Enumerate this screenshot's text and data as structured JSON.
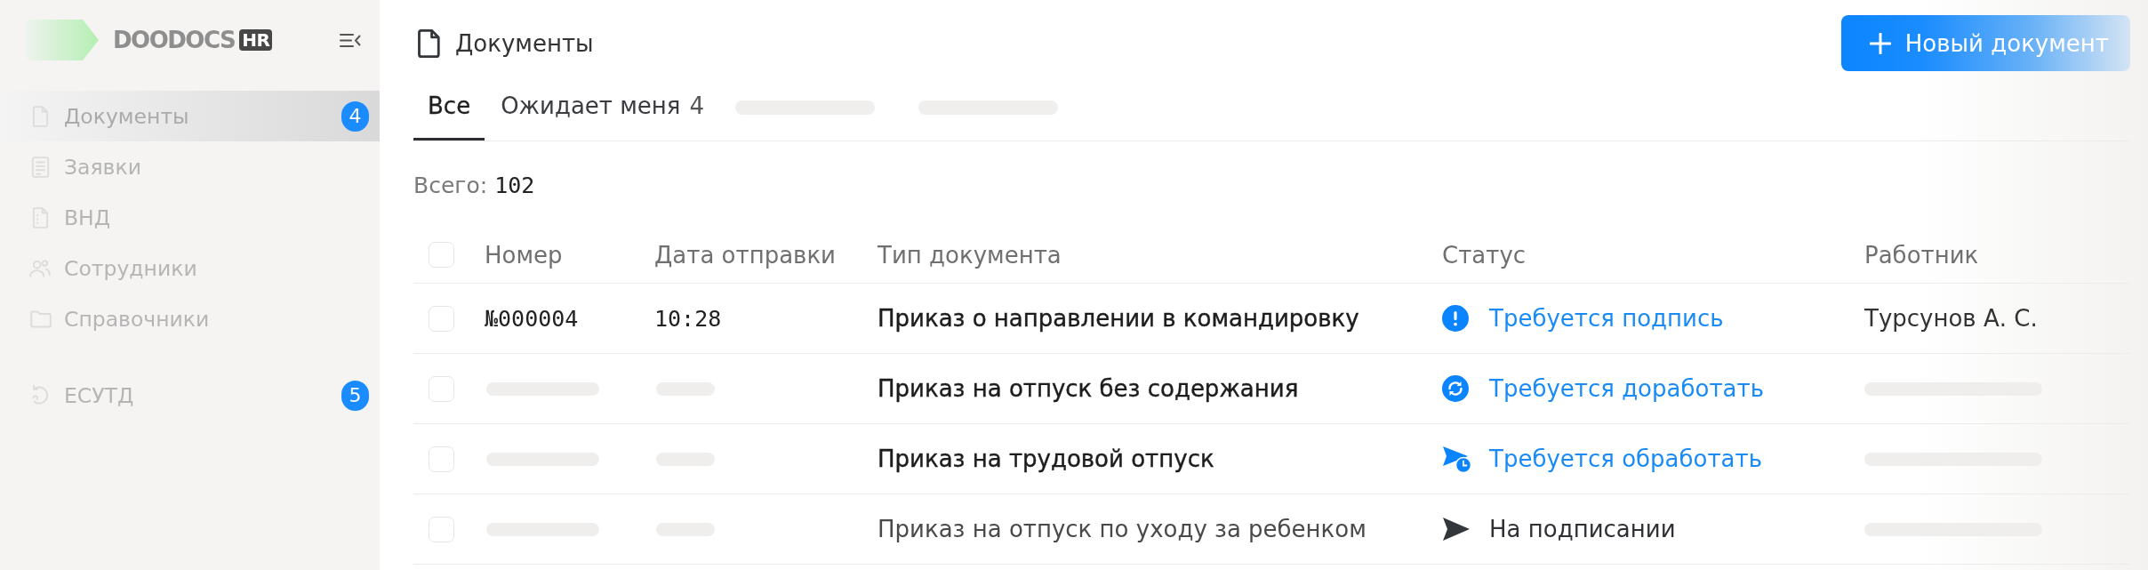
{
  "sidebar": {
    "logo": {
      "text": "DOODOCS",
      "badge": "HR"
    },
    "groups": [
      {
        "items": [
          {
            "label": "Документы",
            "selected": true,
            "badge": "4"
          },
          {
            "label": "Заявки",
            "selected": false
          },
          {
            "label": "ВНД",
            "selected": false
          },
          {
            "label": "Сотрудники",
            "selected": false
          },
          {
            "label": "Справочники",
            "selected": false
          }
        ]
      },
      {
        "items": [
          {
            "label": "ЕСУТД",
            "selected": false,
            "badge": "5"
          }
        ]
      }
    ]
  },
  "header": {
    "title": "Документы",
    "button": "Новый документ"
  },
  "tabs": [
    {
      "kind": "tab",
      "label": "Все",
      "selected": true
    },
    {
      "kind": "tab",
      "label": "Ожидает меня",
      "count": "4",
      "selected": false
    },
    {
      "kind": "skeleton"
    },
    {
      "kind": "skeleton"
    }
  ],
  "total": {
    "label": "Всего:",
    "value": "102"
  },
  "table": {
    "select_all": {
      "checked": false
    },
    "columns": [
      "Номер",
      "Дата отправки",
      "Тип документа",
      "Статус",
      "Работник"
    ],
    "rows": [
      {
        "checked": false,
        "loading": false,
        "unread": true,
        "number": "№000004",
        "date": "10:28",
        "type": "Приказ о направлении в командировку",
        "status": {
          "kind": "signature",
          "label": "Требуется подпись"
        },
        "worker": "Турсунов А. С."
      },
      {
        "checked": false,
        "loading": true,
        "unread": true,
        "type": "Приказ на отпуск без содержания",
        "status": {
          "kind": "revision",
          "label": "Требуется доработать"
        }
      },
      {
        "checked": false,
        "loading": true,
        "unread": true,
        "type": "Приказ на трудовой отпуск",
        "status": {
          "kind": "processing",
          "label": "Требуется обработать"
        }
      },
      {
        "checked": false,
        "loading": true,
        "unread": false,
        "type": "Приказ на отпуск по уходу за ребенком",
        "status": {
          "kind": "signing",
          "label": "На подписании"
        }
      }
    ]
  }
}
